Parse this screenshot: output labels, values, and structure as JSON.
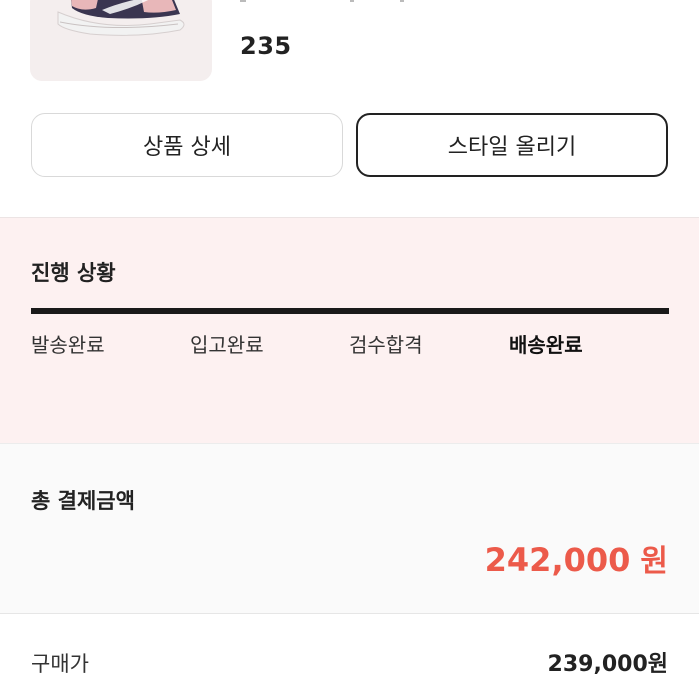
{
  "product": {
    "size": "235",
    "image_icon": "sneaker-image-icon"
  },
  "buttons": {
    "detail_label": "상품 상세",
    "style_label": "스타일 올리기"
  },
  "progress": {
    "title": "진행 상황",
    "steps": [
      "발송완료",
      "입고완료",
      "검수합격",
      "배송완료"
    ],
    "current_step_index": 3,
    "completion_fraction": 1.0
  },
  "payment": {
    "total_title": "총 결제금액",
    "total_amount": "242,000",
    "total_unit": "원",
    "purchase_label": "구매가",
    "purchase_value": "239,000원"
  },
  "colors": {
    "accent": "#ec5a4a",
    "progress_bg": "#fdf1f1",
    "bar": "#1a1a1a"
  }
}
